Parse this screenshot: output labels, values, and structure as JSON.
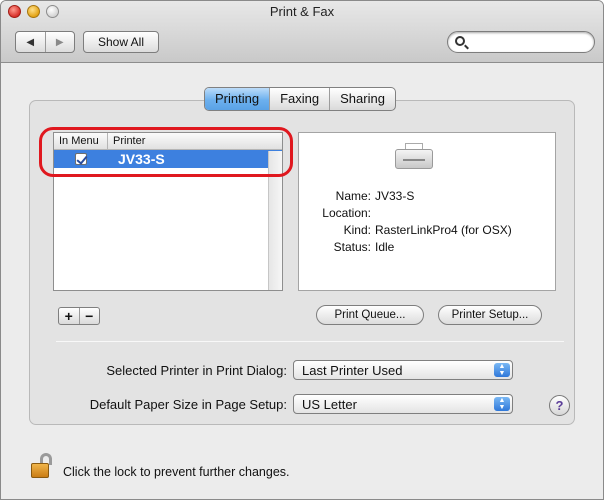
{
  "window": {
    "title": "Print & Fax"
  },
  "toolbar": {
    "back_glyph": "◀",
    "forward_glyph": "▶",
    "show_all_label": "Show All",
    "search_placeholder": ""
  },
  "tabs": [
    {
      "label": "Printing",
      "active": true
    },
    {
      "label": "Faxing",
      "active": false
    },
    {
      "label": "Sharing",
      "active": false
    }
  ],
  "printer_list": {
    "columns": [
      "In Menu",
      "Printer"
    ],
    "rows": [
      {
        "in_menu": true,
        "name": "JV33-S",
        "selected": true
      }
    ]
  },
  "printer_info": {
    "name_label": "Name:",
    "name_value": "JV33-S",
    "location_label": "Location:",
    "location_value": "",
    "kind_label": "Kind:",
    "kind_value": "RasterLinkPro4 (for OSX)",
    "status_label": "Status:",
    "status_value": "Idle"
  },
  "list_buttons": {
    "add": "+",
    "remove": "−"
  },
  "buttons": {
    "print_queue": "Print Queue...",
    "printer_setup": "Printer Setup..."
  },
  "settings": {
    "selected_printer_label": "Selected Printer in Print Dialog:",
    "selected_printer_value": "Last Printer Used",
    "paper_size_label": "Default Paper Size in Page Setup:",
    "paper_size_value": "US Letter"
  },
  "help": {
    "glyph": "?"
  },
  "footer": {
    "lock_text": "Click the lock to prevent further changes."
  },
  "colors": {
    "selection_blue": "#3d80df",
    "highlight_ring": "#e0181f",
    "active_tab": "#6cb0ee"
  }
}
